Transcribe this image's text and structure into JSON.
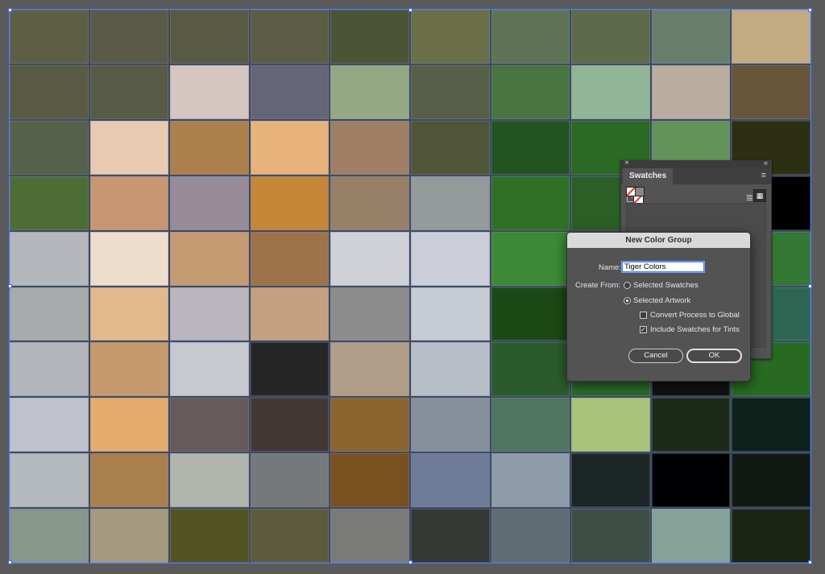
{
  "artboard": {
    "colors": [
      "#5e5e45",
      "#5a5a46",
      "#595a43",
      "#5b5c43",
      "#4b5536",
      "#6b704a",
      "#5f7454",
      "#5f6a4a",
      "#687e6a",
      "#c3ab81",
      "#585a44",
      "#575b45",
      "#d5c6c2",
      "#666577",
      "#94a884",
      "#585f48",
      "#4a7442",
      "#93b597",
      "#b9ada0",
      "#67553a",
      "#55614a",
      "#e8cab3",
      "#ad7f4c",
      "#e7b37b",
      "#9f7f66",
      "#505538",
      "#225321",
      "#2a6a22",
      "#63935a",
      "#2c2f11",
      "#4e6d35",
      "#c89671",
      "#968b97",
      "#c68637",
      "#977f68",
      "#959a9b",
      "#2f7026",
      "#2b5f26",
      "#2e6e2a",
      "#010101",
      "#b4b7bb",
      "#efddcb",
      "#c59b72",
      "#9e7349",
      "#cfd1d7",
      "#cbced8",
      "#3c8a36",
      "#2f7a30",
      "#317a33",
      "#337834",
      "#a7abab",
      "#e2b98a",
      "#bbb5bd",
      "#c5a080",
      "#8c8c8c",
      "#c7cbd4",
      "#1c4815",
      "#2b6a2b",
      "#2d6a41",
      "#2c6653",
      "#b2b5b9",
      "#c79a6d",
      "#c6c9cd",
      "#262626",
      "#b29d88",
      "#b7bec6",
      "#2b5b2c",
      "#2a6a2a",
      "#121311",
      "#296a22",
      "#bfc2cd",
      "#e4ac6b",
      "#665a5a",
      "#433735",
      "#8c6430",
      "#878f9c",
      "#4f7461",
      "#a8c279",
      "#1c2a17",
      "#0d211b",
      "#b3b9bd",
      "#ab804f",
      "#b2b5ad",
      "#76797b",
      "#795020",
      "#6e7c97",
      "#8d9ca8",
      "#1c2627",
      "#010103",
      "#121913",
      "#87978b",
      "#a59a80",
      "#525522",
      "#5c5b3d",
      "#7a7a78",
      "#333932",
      "#606c74",
      "#3f4e44",
      "#86a39a",
      "#1c2513"
    ]
  },
  "swatches_panel": {
    "close_glyph": "×",
    "collapse_glyph": "«",
    "tab_label": "Swatches",
    "menu_glyph": "≡",
    "question_glyph": "?",
    "list_view_glyph": "≣",
    "grid_view_glyph": "▦"
  },
  "dialog": {
    "title": "New Color Group",
    "name_label": "Name:",
    "name_value": "Tiger Colors",
    "create_from_label": "Create From:",
    "option_selected_swatches": "Selected Swatches",
    "option_selected_artwork": "Selected Artwork",
    "selected_option": "Selected Artwork",
    "convert_label": "Convert Process to Global",
    "convert_checked": false,
    "include_label": "Include Swatches for Tints",
    "include_checked": true,
    "check_glyph": "✓",
    "cancel_label": "Cancel",
    "ok_label": "OK"
  }
}
